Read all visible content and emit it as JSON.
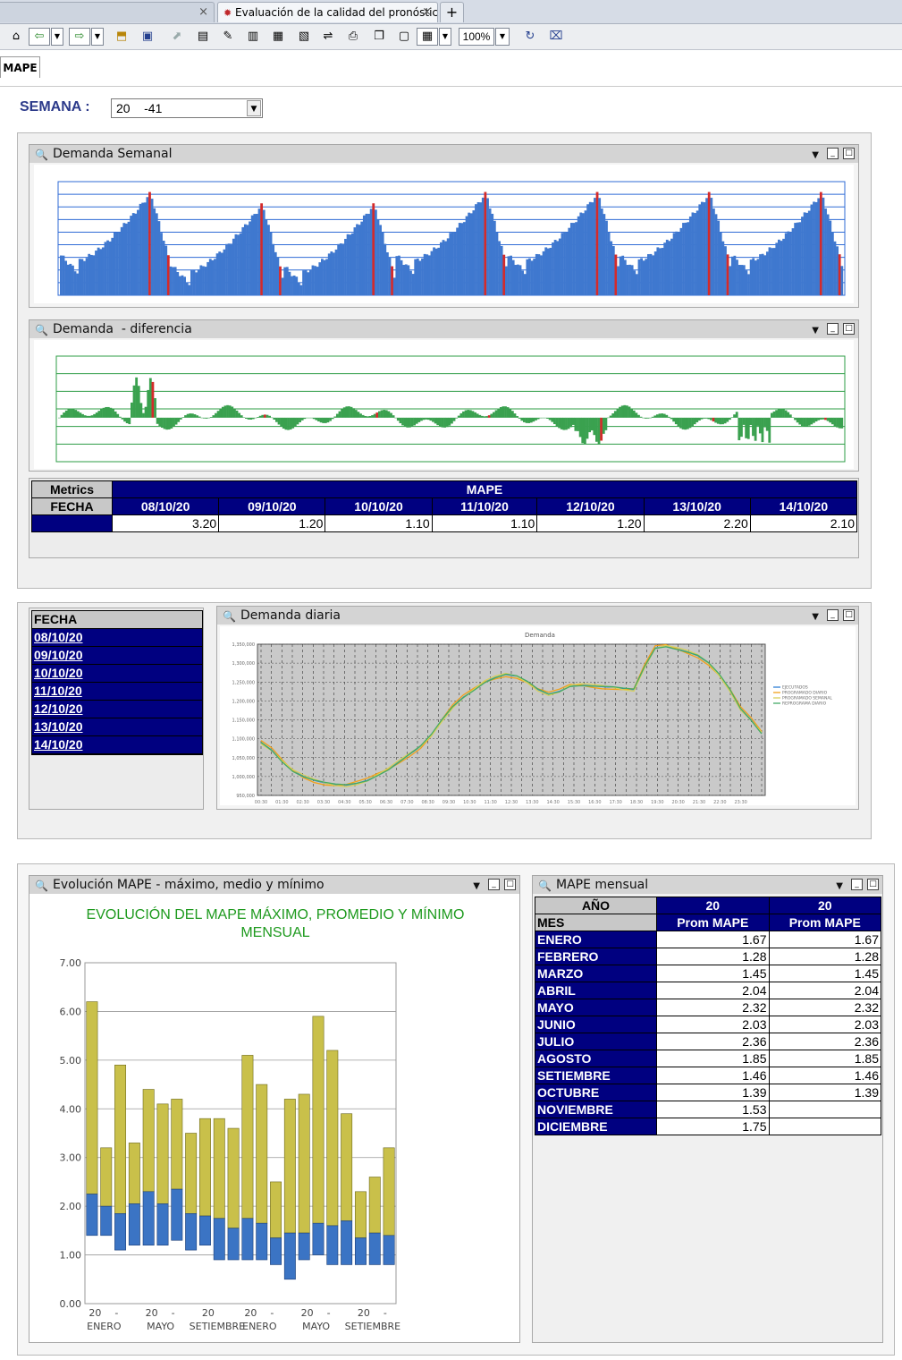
{
  "browser": {
    "tab_active_title": "Evaluación de la calidad del pronóstic...",
    "new_tab": "+",
    "close": "×",
    "zoom": "100%"
  },
  "sheet_tab": "MAPE",
  "semana": {
    "label": "SEMANA :",
    "value": "20    -41"
  },
  "panels": {
    "weekly": "Demanda Semanal",
    "diff": "Demanda  - diferencia",
    "daily": "Demanda diaria",
    "evolution": "Evolución MAPE - máximo, medio y mínimo",
    "monthly": "MAPE mensual"
  },
  "metrics_table": {
    "corner_top": "Metrics",
    "corner_bottom": "FECHA",
    "group": "MAPE",
    "dates": [
      "08/10/20",
      "09/10/20",
      "10/10/20",
      "11/10/20",
      "12/10/20",
      "13/10/20",
      "14/10/20"
    ],
    "values": [
      "3.20",
      "1.20",
      "1.10",
      "1.10",
      "1.20",
      "2.20",
      "2.10"
    ]
  },
  "fecha_list": {
    "header": "FECHA",
    "items": [
      "08/10/20",
      "09/10/20",
      "10/10/20",
      "11/10/20",
      "12/10/20",
      "13/10/20",
      "14/10/20"
    ]
  },
  "daily_chart": {
    "title": "Demanda",
    "yticks": [
      "1,350,000",
      "1,300,000",
      "1,250,000",
      "1,200,000",
      "1,150,000",
      "1,100,000",
      "1,050,000",
      "1,000,000",
      "950,000"
    ],
    "xticks": [
      "00:30",
      "01:30",
      "02:30",
      "03:30",
      "04:30",
      "05:30",
      "06:30",
      "07:30",
      "08:30",
      "09:30",
      "10:30",
      "11:30",
      "12:30",
      "13:30",
      "14:30",
      "15:30",
      "16:30",
      "17:30",
      "18:30",
      "19:30",
      "20:30",
      "21:30",
      "22:30",
      "23:30"
    ],
    "legend": [
      "EJECUTADOS",
      "PROGRAMADO DIARIO",
      "PROGRAMADO SEMANAL",
      "REPROGRAMA DIARIO"
    ],
    "colors": [
      "#2f7fd6",
      "#f2a11a",
      "#d8d05a",
      "#44aa66"
    ]
  },
  "monthly_table": {
    "anio_label": "AÑO",
    "mes_label": "MES",
    "years": [
      "20",
      "20"
    ],
    "col_label": "Prom MAPE",
    "rows": [
      {
        "mes": "ENERO",
        "a": "1.67",
        "b": "1.67"
      },
      {
        "mes": "FEBRERO",
        "a": "1.28",
        "b": "1.28"
      },
      {
        "mes": "MARZO",
        "a": "1.45",
        "b": "1.45"
      },
      {
        "mes": "ABRIL",
        "a": "2.04",
        "b": "2.04"
      },
      {
        "mes": "MAYO",
        "a": "2.32",
        "b": "2.32"
      },
      {
        "mes": "JUNIO",
        "a": "2.03",
        "b": "2.03"
      },
      {
        "mes": "JULIO",
        "a": "2.36",
        "b": "2.36"
      },
      {
        "mes": "AGOSTO",
        "a": "1.85",
        "b": "1.85"
      },
      {
        "mes": "SETIEMBRE",
        "a": "1.46",
        "b": "1.46"
      },
      {
        "mes": "OCTUBRE",
        "a": "1.39",
        "b": "1.39"
      },
      {
        "mes": "NOVIEMBRE",
        "a": "1.53",
        "b": ""
      },
      {
        "mes": "DICIEMBRE",
        "a": "1.75",
        "b": ""
      }
    ]
  },
  "chart_data": {
    "type": "bar",
    "title": "EVOLUCIÓN DEL MAPE MÁXIMO, PROMEDIO Y MÍNIMO MENSUAL",
    "ylim": [
      0,
      7
    ],
    "yticks": [
      "0.00",
      "1.00",
      "2.00",
      "3.00",
      "4.00",
      "5.00",
      "6.00",
      "7.00"
    ],
    "xtick_labels": [
      {
        "top": "20",
        "dash": "-",
        "bottom": "ENERO"
      },
      {
        "top": "20",
        "dash": "-",
        "bottom": "MAYO"
      },
      {
        "top": "20",
        "dash": "",
        "bottom": "SETIEMBRE"
      },
      {
        "top": "20",
        "dash": "-",
        "bottom": "ENERO"
      },
      {
        "top": "20",
        "dash": "-",
        "bottom": "MAYO"
      },
      {
        "top": "20",
        "dash": "-",
        "bottom": "SETIEMBRE"
      }
    ],
    "max": [
      6.2,
      3.2,
      4.9,
      3.3,
      4.4,
      4.1,
      4.2,
      3.5,
      3.8,
      3.8,
      3.6,
      5.1,
      4.5,
      2.5,
      4.2,
      4.3,
      5.9,
      5.2,
      3.9,
      2.3,
      2.6,
      3.2
    ],
    "mean": [
      2.25,
      2.0,
      1.85,
      2.05,
      2.3,
      2.05,
      2.35,
      1.85,
      1.8,
      1.75,
      1.55,
      1.75,
      1.65,
      1.35,
      1.45,
      1.45,
      1.65,
      1.6,
      1.7,
      1.35,
      1.45,
      1.4
    ],
    "min": [
      1.4,
      1.4,
      1.1,
      1.2,
      1.2,
      1.2,
      1.3,
      1.1,
      1.2,
      0.9,
      0.9,
      0.9,
      0.9,
      0.8,
      0.5,
      0.9,
      1.0,
      0.8,
      0.8,
      0.8,
      0.8,
      0.8
    ],
    "colors": {
      "upper": "#c9c04a",
      "lower": "#3b74c4",
      "title": "#1e9a1e"
    }
  }
}
